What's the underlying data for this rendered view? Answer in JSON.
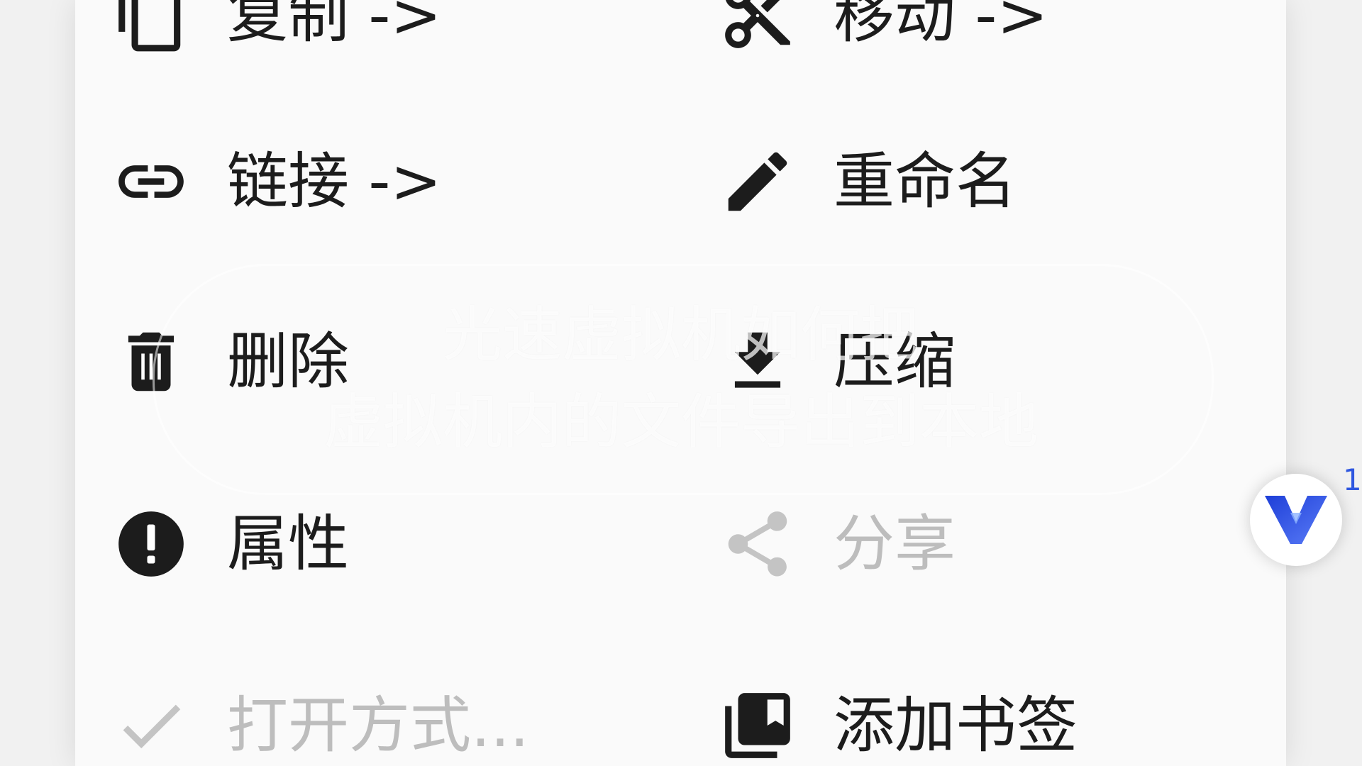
{
  "menu": {
    "items": [
      {
        "label": "复制 ->",
        "icon": "copy-icon",
        "enabled": true
      },
      {
        "label": "移动 ->",
        "icon": "scissors-icon",
        "enabled": true
      },
      {
        "label": "链接 ->",
        "icon": "link-icon",
        "enabled": true
      },
      {
        "label": "重命名",
        "icon": "pencil-icon",
        "enabled": true
      },
      {
        "label": "删除",
        "icon": "trash-icon",
        "enabled": true
      },
      {
        "label": "压缩",
        "icon": "download-icon",
        "enabled": true
      },
      {
        "label": "属性",
        "icon": "info-icon",
        "enabled": true
      },
      {
        "label": "分享",
        "icon": "share-icon",
        "enabled": false
      },
      {
        "label": "打开方式...",
        "icon": "check-icon",
        "enabled": false
      },
      {
        "label": "添加书签",
        "icon": "bookmark-icon",
        "enabled": true
      }
    ]
  },
  "subtitle": {
    "line1": "光速虚拟机如何把",
    "line2": "虚拟机内的文件导出到本地"
  },
  "floating_widget": {
    "icon": "v-logo-icon",
    "count": "1"
  },
  "colors": {
    "text": "#1c1c1c",
    "disabled_text": "#bdbdbd",
    "panel_bg": "#fafafa",
    "accent": "#2f57e0"
  }
}
